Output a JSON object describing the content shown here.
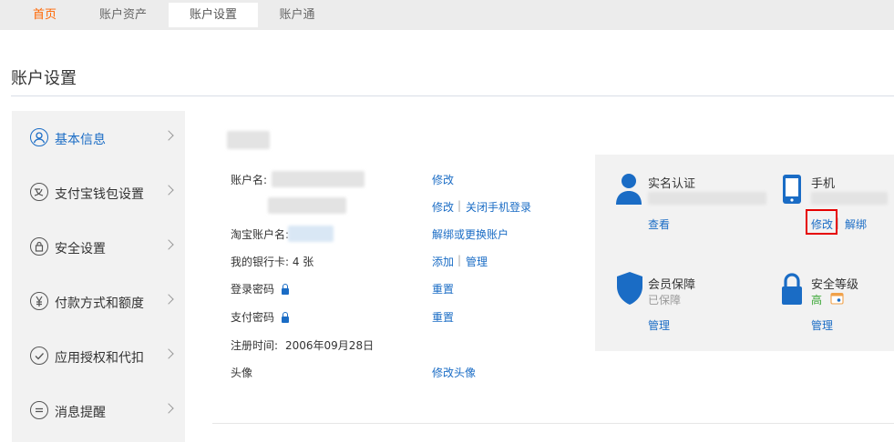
{
  "topnav": {
    "tabs": [
      {
        "label": "首页"
      },
      {
        "label": "账户资产"
      },
      {
        "label": "账户设置"
      },
      {
        "label": "账户通"
      }
    ]
  },
  "page_title": "账户设置",
  "sidebar": {
    "items": [
      {
        "label": "基本信息",
        "icon": "user-icon"
      },
      {
        "label": "支付宝钱包设置",
        "icon": "wallet-icon"
      },
      {
        "label": "安全设置",
        "icon": "lock-icon"
      },
      {
        "label": "付款方式和额度",
        "icon": "yen-icon"
      },
      {
        "label": "应用授权和代扣",
        "icon": "check-icon"
      },
      {
        "label": "消息提醒",
        "icon": "message-icon"
      }
    ]
  },
  "info": {
    "account_name_label": "账户名:",
    "modify": "修改",
    "modify2": "修改",
    "close_phone_login": "关闭手机登录",
    "taobao_label": "淘宝账户名:",
    "unbind_or_change": "解绑或更换账户",
    "bank_card_label": "我的银行卡: 4 张",
    "add": "添加",
    "manage": "管理",
    "login_pwd_label": "登录密码",
    "reset1": "重置",
    "pay_pwd_label": "支付密码",
    "reset2": "重置",
    "register_time_label": "注册时间:",
    "register_time_value": "2006年09月28日",
    "avatar_label": "头像",
    "modify_avatar": "修改头像",
    "sep": "|"
  },
  "panel": {
    "realname": {
      "title": "实名认证",
      "action": "查看"
    },
    "phone": {
      "title": "手机",
      "modify": "修改",
      "unbind": "解绑"
    },
    "member": {
      "title": "会员保障",
      "status": "已保障",
      "action": "管理"
    },
    "security": {
      "title": "安全等级",
      "level": "高",
      "action": "管理"
    }
  },
  "colors": {
    "accent": "#1a6cc5",
    "home": "#ff6600",
    "highlight": "#e60000",
    "green": "#3aa735"
  }
}
